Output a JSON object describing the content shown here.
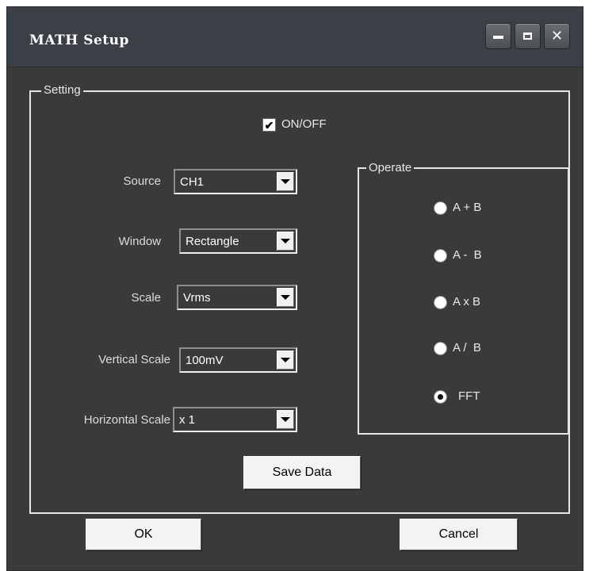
{
  "window": {
    "title": "MATH Setup"
  },
  "titlebar_buttons": {
    "minimize": "minimize-icon",
    "maximize": "maximize-icon",
    "close": "close-icon"
  },
  "setting": {
    "legend": "Setting",
    "onoff": {
      "label": "ON/OFF",
      "checked": true
    },
    "source": {
      "label": "Source",
      "value": "CH1"
    },
    "window_fn": {
      "label": "Window",
      "value": "Rectangle"
    },
    "scale": {
      "label": "Scale",
      "value": "Vrms"
    },
    "vertical_scale": {
      "label": "Vertical Scale",
      "value": "100mV"
    },
    "horizontal_scale": {
      "label": "Horizontal Scale",
      "value": "x 1"
    },
    "save_button": "Save Data"
  },
  "operate": {
    "legend": "Operate",
    "options": [
      {
        "label": "A + B",
        "selected": false
      },
      {
        "label": "A -  B",
        "selected": false
      },
      {
        "label": "A x B",
        "selected": false
      },
      {
        "label": "A /  B",
        "selected": false
      },
      {
        "label": "FFT",
        "selected": true
      }
    ]
  },
  "footer": {
    "ok": "OK",
    "cancel": "Cancel"
  }
}
